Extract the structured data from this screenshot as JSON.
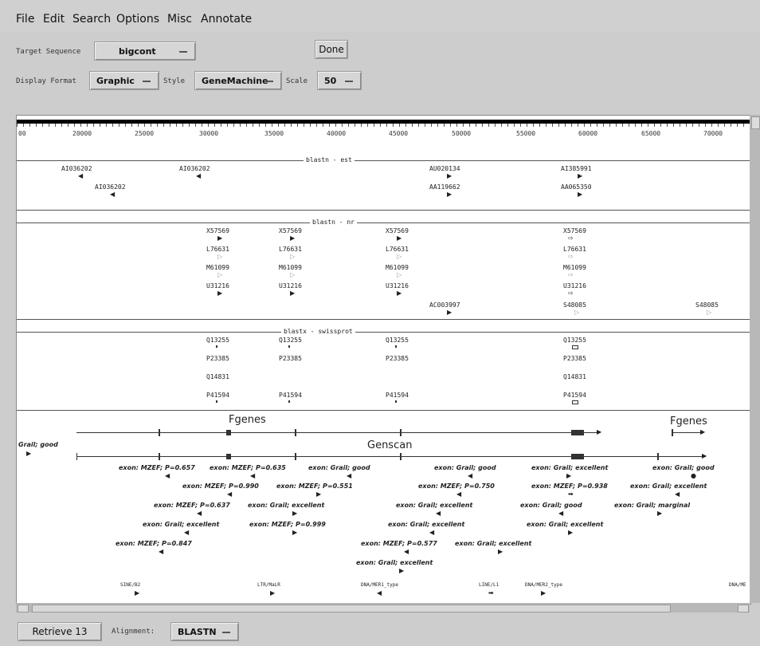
{
  "menu": {
    "file": "File",
    "edit": "Edit",
    "search": "Search",
    "options": "Options",
    "misc": "Misc",
    "annotate": "Annotate"
  },
  "target": {
    "label": "Target Sequence",
    "value": "bigcont",
    "done": "Done"
  },
  "display": {
    "format_label": "Display Format",
    "format_value": "Graphic",
    "style_label": "Style",
    "style_value": "GeneMachine",
    "scale_label": "Scale",
    "scale_value": "50"
  },
  "ruler": {
    "ticks": [
      "00",
      "20000",
      "25000",
      "30000",
      "35000",
      "40000",
      "45000",
      "50000",
      "55000",
      "60000",
      "65000",
      "70000"
    ]
  },
  "sections": {
    "est": {
      "title": "blastn - est",
      "hits": [
        "AI036202",
        "AI036202",
        "AI036202",
        "AU020134",
        "AA119662",
        "AI385991",
        "AA065350"
      ]
    },
    "nr": {
      "title": "blastn - nr",
      "hits": [
        "X57569",
        "X57569",
        "X57569",
        "X57569",
        "L76631",
        "L76631",
        "L76631",
        "L76631",
        "M61099",
        "M61099",
        "M61099",
        "M61099",
        "U31216",
        "U31216",
        "U31216",
        "U31216",
        "AC003997",
        "S48085",
        "S48085"
      ]
    },
    "swissprot": {
      "title": "blastx - swissprot",
      "hits": [
        "Q13255",
        "Q13255",
        "Q13255",
        "Q13255",
        "P23385",
        "P23385",
        "P23385",
        "P23385",
        "Q14831",
        "Q14831",
        "P41594",
        "P41594",
        "P41594",
        "P41594"
      ]
    }
  },
  "genes": {
    "fgenes1": "Fgenes",
    "fgenes2": "Fgenes",
    "genscan": "Genscan",
    "grail_good": "Grail; good",
    "exons": [
      "exon: MZEF; P=0.657",
      "exon: MZEF; P=0.635",
      "exon: Grail; good",
      "exon: Grail; good",
      "exon: Grail; excellent",
      "exon: Grail; good",
      "exon: MZEF; P=0.990",
      "exon: MZEF; P=0.551",
      "exon: MZEF; P=0.750",
      "exon: MZEF; P=0.938",
      "exon: Grail; excellent",
      "exon: MZEF; P=0.637",
      "exon: Grail; excellent",
      "exon: Grail; excellent",
      "exon: Grail; good",
      "exon: Grail; marginal",
      "exon: Grail; excellent",
      "exon: MZEF; P=0.999",
      "exon: Grail; excellent",
      "exon: Grail; excellent",
      "exon: MZEF; P=0.847",
      "exon: MZEF; P=0.577",
      "exon: Grail; excellent",
      "exon: Grail; excellent"
    ]
  },
  "repeats": [
    "SINE/B2",
    "LTR/MaLR",
    "DNA/MER1_type",
    "LINE/L1",
    "DNA/MER2_type",
    "DNA/ME"
  ],
  "bottom": {
    "retrieve": "Retrieve 13",
    "alignment_label": "Alignment:",
    "alignment_value": "BLASTN"
  }
}
